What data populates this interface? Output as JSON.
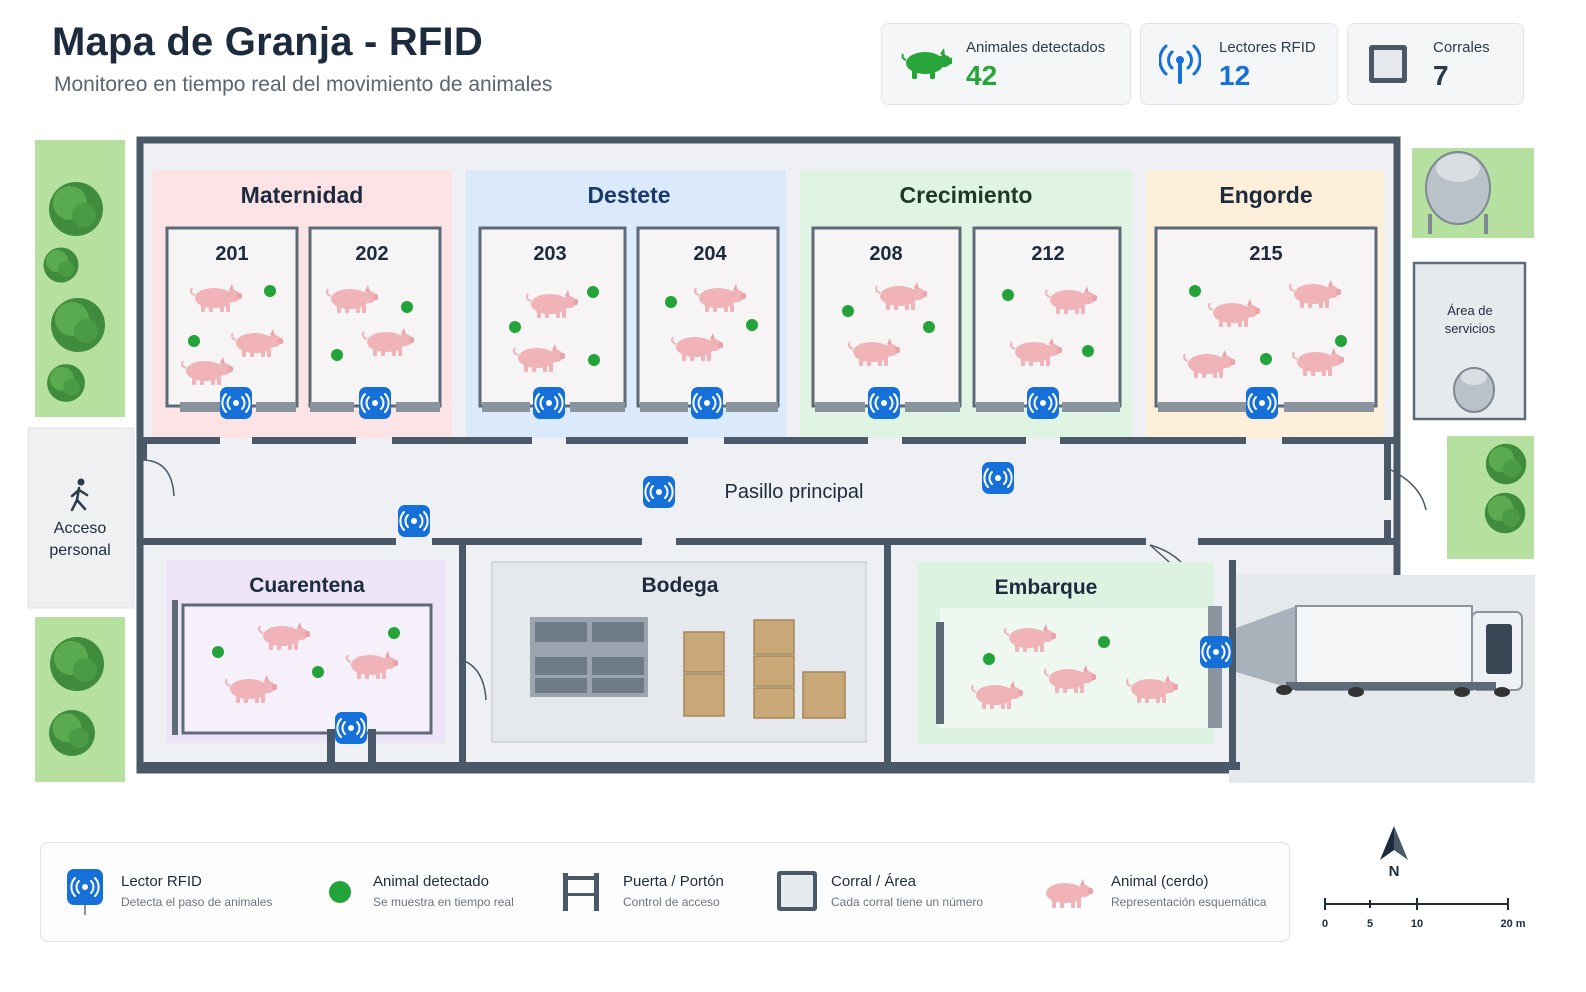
{
  "header": {
    "title": "Mapa de Granja - RFID",
    "subtitle": "Monitoreo en tiempo real del movimiento de animales"
  },
  "stats": [
    {
      "label": "Animales detectados",
      "value": "42",
      "icon": "pig-icon",
      "color": "#27a539"
    },
    {
      "label": "Lectores RFID",
      "value": "12",
      "icon": "antenna-icon",
      "color": "#1670d9"
    },
    {
      "label": "Corrales",
      "value": "7",
      "icon": "pen-square-icon",
      "color": "#2a3a4a"
    }
  ],
  "zones": {
    "maternidad": "Maternidad",
    "destete": "Destete",
    "crecimiento": "Crecimiento",
    "engorde": "Engorde",
    "cuarentena": "Cuarentena",
    "bodega": "Bodega",
    "embarque": "Embarque",
    "pasillo": "Pasillo principal",
    "servicios_1": "Área de",
    "servicios_2": "servicios",
    "acceso_1": "Acceso",
    "acceso_2": "personal"
  },
  "pens": [
    "201",
    "202",
    "203",
    "204",
    "208",
    "212",
    "215"
  ],
  "colors": {
    "maternidad": "#fbe3e6",
    "destete": "#dbeafb",
    "crecimiento": "#e0f4e3",
    "engorde": "#fdefd9",
    "cuarentena": "#ede4f7",
    "embarque": "#ddf3e2",
    "wall": "#4a5968",
    "reader": "#1670d9",
    "dot": "#23a33a",
    "pig": "#efb3b8"
  },
  "legend": [
    {
      "title": "Lector RFID",
      "desc": "Detecta el paso de animales",
      "icon": "rfid-reader-icon"
    },
    {
      "title": "Animal detectado",
      "desc": "Se muestra en tiempo real",
      "icon": "green-dot-icon"
    },
    {
      "title": "Puerta / Portón",
      "desc": "Control de acceso",
      "icon": "gate-icon"
    },
    {
      "title": "Corral / Área",
      "desc": "Cada corral tiene un número",
      "icon": "pen-icon"
    },
    {
      "title": "Animal (cerdo)",
      "desc": "Representación esquemática",
      "icon": "pig-icon"
    }
  ],
  "compass": {
    "north": "N",
    "scale": [
      "0",
      "5",
      "10",
      "20 m"
    ]
  }
}
